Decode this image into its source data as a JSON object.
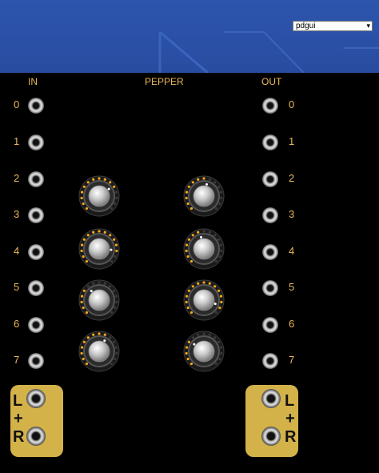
{
  "window": {
    "dropdown_value": "pdgui",
    "dropdown_arrow": "chevron-down-icon"
  },
  "module": {
    "title": "PEPPER",
    "in_label": "IN",
    "out_label": "OUT",
    "channel_labels": [
      "0",
      "1",
      "2",
      "3",
      "4",
      "5",
      "6",
      "7"
    ],
    "knob_levels": [
      0.7,
      0.55,
      0.85,
      0.45,
      0.35,
      0.9,
      0.6,
      0.3
    ],
    "left_io": {
      "top": "L",
      "mid": "+",
      "bottom": "R"
    },
    "right_io": {
      "top": "L",
      "mid": "+",
      "bottom": "R"
    },
    "colors": {
      "accent": "#e8b85a",
      "led": "#f7a818",
      "io_box": "#d4b24a",
      "header": "#2a50a6"
    }
  }
}
